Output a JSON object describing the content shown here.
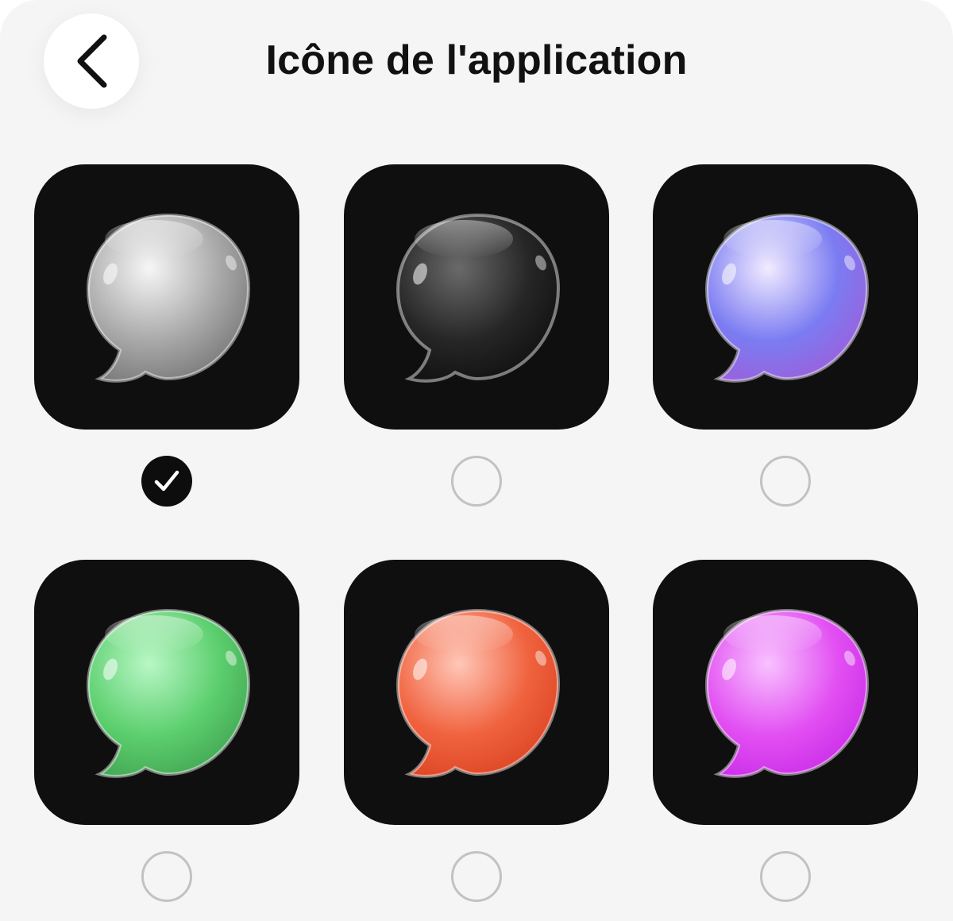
{
  "header": {
    "title": "Icône de l'application",
    "back_icon": "chevron-left-icon"
  },
  "icon_options": [
    {
      "variant": "silver",
      "selected": true,
      "colors": {
        "light": "#f6f6f6",
        "mid": "#a9a9a9",
        "dark": "#6f6f6f"
      }
    },
    {
      "variant": "black",
      "selected": false,
      "colors": {
        "light": "#6a6a6a",
        "mid": "#262626",
        "dark": "#0c0c0c"
      }
    },
    {
      "variant": "purple",
      "selected": false,
      "colors": {
        "light": "#f2ecff",
        "mid": "#7b7cf2",
        "dark": "#a15ad6"
      }
    },
    {
      "variant": "green",
      "selected": false,
      "colors": {
        "light": "#b9f7c6",
        "mid": "#5ccf6e",
        "dark": "#3f9e4f"
      }
    },
    {
      "variant": "red",
      "selected": false,
      "colors": {
        "light": "#ffc7b8",
        "mid": "#f0623e",
        "dark": "#d8401f"
      }
    },
    {
      "variant": "magenta",
      "selected": false,
      "colors": {
        "light": "#f8c2ff",
        "mid": "#e24ff2",
        "dark": "#c628e6"
      }
    }
  ],
  "radio_check_icon": "checkmark-icon"
}
